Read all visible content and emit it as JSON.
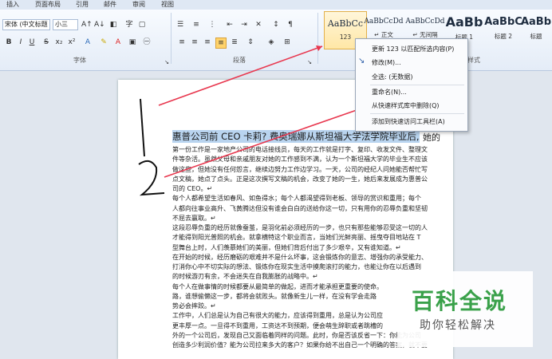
{
  "tabs": [
    "插入",
    "页面布局",
    "引用",
    "邮件",
    "审阅",
    "视图"
  ],
  "font": {
    "name": "宋体 (中文标题",
    "size": "小三"
  },
  "groups": {
    "font_label": "字体",
    "paragraph_label": "段落",
    "styles_label": "样式"
  },
  "styles": [
    {
      "sample": "AaBbCc",
      "name": "123"
    },
    {
      "sample": "AaBbCcDd",
      "name": "↵ 正文"
    },
    {
      "sample": "AaBbCcDd",
      "name": "↵ 无间隔"
    },
    {
      "sample": "AaBb",
      "name": "标题 1"
    },
    {
      "sample": "AaBbC",
      "name": "标题 2"
    },
    {
      "sample": "AaBb",
      "name": "标题"
    }
  ],
  "context_menu": [
    "更新 123 以匹配所选内容(P)",
    "修改(M)...",
    "全选: (无数据)",
    "重命名(N)...",
    "从快速样式库中删除(Q)",
    "添加到快速访问工具栏(A)"
  ],
  "document": {
    "title": "惠普公司前 CEO 卡莉? 费奥瑞娜从斯坦福大学法学院毕业后,",
    "title_tail": "她的",
    "paragraphs": [
      "第一份工作是一家地产公司的电话接线员，每天的工作就是打字、复印、收发文件、整理文",
      "件等杂活。虽然父母和亲戚朋友对她的工作感到不满，认为一个斯坦福大学的毕业生不应该",
      "做这些，但她没有任何怨言，继续边努力工作边学习。一天，公司的经纪人问她能否帮忙写",
      "点文稿，她点了点头。正是这次撰写文稿的机会，改变了她的一生，她后来发展成为惠普公",
      "司的 CEO。↵",
      "每个人都希望生活如春风、如鱼得水；每个人都渴望得到老板、领导的赏识和重用；每个",
      "人都向往事业高升、飞黄腾达但没有谁会白白的送给你这一切，只有用你的忍辱负重和坚韧",
      "不屈去赢取。↵",
      "这段忍辱负重的经历就像蚕茧，是羽化前必须经历的一步，也只有那些能够忍受这一切的人",
      "才能得到阳光普照的机会。就拿横特这个职业而言，当她们光鲜亮丽、摇曳夺目地站在 T",
      "型舞台上时，人们羡慕她们的美丽，但她们背后付出了多少艰辛，又有谁知道。↵",
      "在开始的时候，经历磨砺的艰难并不是什么坏事，这会锻炼你的意志、增强你的承受能力、",
      "打消你心中不切实际的想法、锻炼你在现实生活中摸爬滚打的能力，也能让你在以后遇到",
      "的时候游刃有余，不会迷失在自我膨胀的战略中。↵",
      "每个人在做事情的时候都要从最简单的做起，进而才能承担更重要的使命。",
      "路，谁想偷懒这一步，都将会就败头。就像新生儿一样，在没有学会走路",
      "势必会摔跤。↵",
      "工作中，人们总是认为自己有很大的能力，应该得到重用，总是认为公司应",
      "更丰厚一点。一旦得不到重用，工资达不到预期，便会萌生辞职或者跳槽的",
      "外的一个公司后，发现自己又面临着同样的问题。此时，你是否该反省一下：你能为公司",
      "创造多少利润价值？能为公司拉来多大的客户？如果你给不出自己一个明确的答案，就不要"
    ]
  },
  "watermark": {
    "title": "百科全说",
    "subtitle": "助你轻松解决"
  },
  "colors": {
    "accent": "#e8384f",
    "highlight": "#b9d4ef",
    "watermark_green": "#3aa14a"
  }
}
